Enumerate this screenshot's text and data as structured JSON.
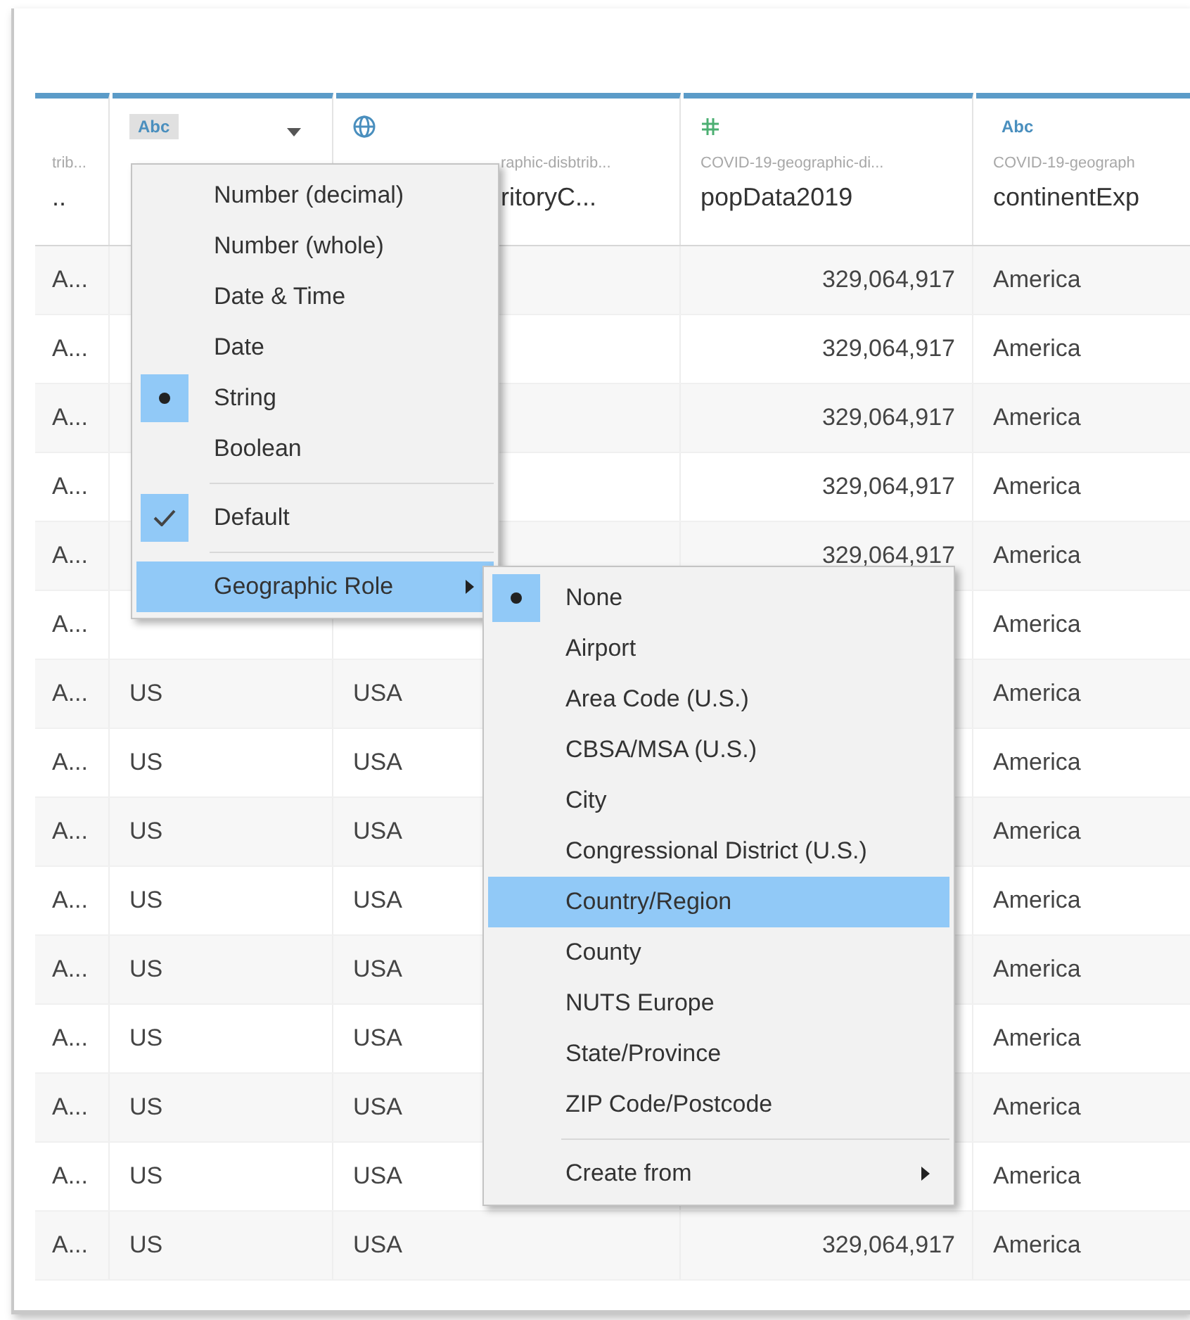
{
  "table": {
    "columns": [
      {
        "kind": "plain",
        "source": "trib...",
        "name": ".."
      },
      {
        "kind": "string",
        "tag": "Abc",
        "dropdown": true
      },
      {
        "kind": "geo",
        "source": "raphic-disbtrib...",
        "name": "ritoryC..."
      },
      {
        "kind": "number",
        "source": "COVID-19-geographic-di...",
        "name": "popData2019"
      },
      {
        "kind": "string",
        "tag": "Abc",
        "source": "COVID-19-geograph",
        "name": "continentExp"
      }
    ],
    "rows": [
      {
        "cells": [
          "A...",
          null,
          null,
          "329,064,917",
          "America"
        ]
      },
      {
        "cells": [
          "A...",
          null,
          null,
          "329,064,917",
          "America"
        ]
      },
      {
        "cells": [
          "A...",
          null,
          null,
          "329,064,917",
          "America"
        ]
      },
      {
        "cells": [
          "A...",
          null,
          null,
          "329,064,917",
          "America"
        ]
      },
      {
        "cells": [
          "A...",
          null,
          null,
          "329,064,917",
          "America"
        ]
      },
      {
        "cells": [
          "A...",
          null,
          null,
          null,
          "America"
        ]
      },
      {
        "cells": [
          "A...",
          "US",
          "USA",
          null,
          "America"
        ]
      },
      {
        "cells": [
          "A...",
          "US",
          "USA",
          null,
          "America"
        ]
      },
      {
        "cells": [
          "A...",
          "US",
          "USA",
          null,
          "America"
        ]
      },
      {
        "cells": [
          "A...",
          "US",
          "USA",
          null,
          "America"
        ]
      },
      {
        "cells": [
          "A...",
          "US",
          "USA",
          null,
          "America"
        ]
      },
      {
        "cells": [
          "A...",
          "US",
          "USA",
          null,
          "America"
        ]
      },
      {
        "cells": [
          "A...",
          "US",
          "USA",
          null,
          "America"
        ]
      },
      {
        "cells": [
          "A...",
          "US",
          "USA",
          null,
          "America"
        ]
      },
      {
        "cells": [
          "A...",
          "US",
          "USA",
          "329,064,917",
          "America"
        ]
      }
    ]
  },
  "type_menu": {
    "items": [
      {
        "kind": "radio",
        "label": "Number (decimal)",
        "selected": false
      },
      {
        "kind": "radio",
        "label": "Number (whole)",
        "selected": false
      },
      {
        "kind": "radio",
        "label": "Date & Time",
        "selected": false
      },
      {
        "kind": "radio",
        "label": "Date",
        "selected": false
      },
      {
        "kind": "radio",
        "label": "String",
        "selected": true
      },
      {
        "kind": "radio",
        "label": "Boolean",
        "selected": false
      },
      {
        "kind": "separator"
      },
      {
        "kind": "check",
        "label": "Default",
        "checked": true
      },
      {
        "kind": "separator"
      },
      {
        "kind": "submenu",
        "label": "Geographic Role",
        "highlighted": true
      }
    ]
  },
  "geo_menu": {
    "items": [
      {
        "kind": "radio",
        "label": "None",
        "selected": true,
        "highlighted": false
      },
      {
        "kind": "radio",
        "label": "Airport",
        "selected": false,
        "highlighted": false
      },
      {
        "kind": "radio",
        "label": "Area Code (U.S.)",
        "selected": false,
        "highlighted": false
      },
      {
        "kind": "radio",
        "label": "CBSA/MSA (U.S.)",
        "selected": false,
        "highlighted": false
      },
      {
        "kind": "radio",
        "label": "City",
        "selected": false,
        "highlighted": false
      },
      {
        "kind": "radio",
        "label": "Congressional District (U.S.)",
        "selected": false,
        "highlighted": false
      },
      {
        "kind": "radio",
        "label": "Country/Region",
        "selected": false,
        "highlighted": true
      },
      {
        "kind": "radio",
        "label": "County",
        "selected": false,
        "highlighted": false
      },
      {
        "kind": "radio",
        "label": "NUTS Europe",
        "selected": false,
        "highlighted": false
      },
      {
        "kind": "radio",
        "label": "State/Province",
        "selected": false,
        "highlighted": false
      },
      {
        "kind": "radio",
        "label": "ZIP Code/Postcode",
        "selected": false,
        "highlighted": false
      },
      {
        "kind": "separator"
      },
      {
        "kind": "submenu",
        "label": "Create from",
        "highlighted": false
      }
    ]
  }
}
